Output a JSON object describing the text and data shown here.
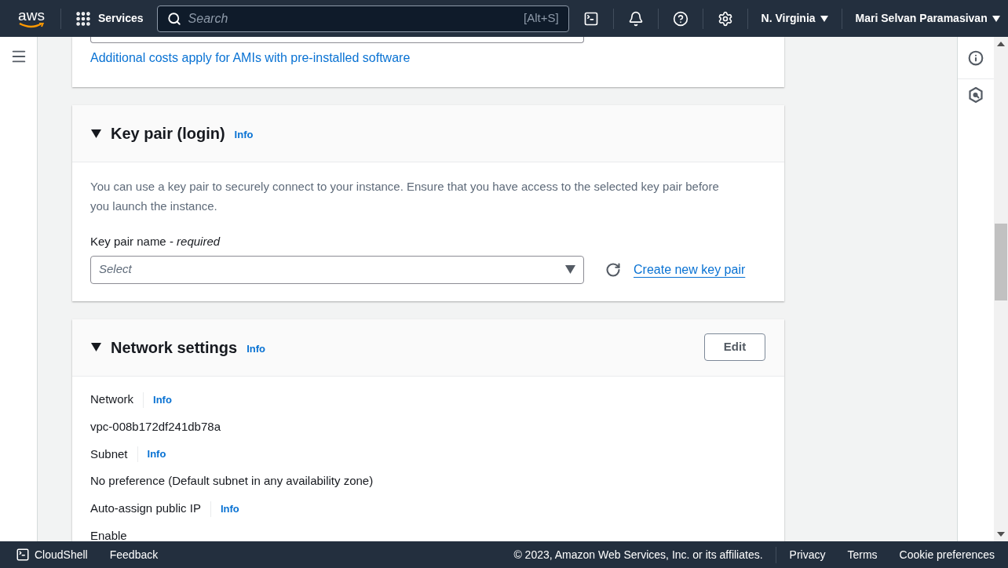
{
  "top_nav": {
    "logo": "aws",
    "services": "Services",
    "search": {
      "placeholder": "Search",
      "shortcut": "[Alt+S]"
    },
    "region": "N. Virginia",
    "user": "Mari Selvan Paramasivan"
  },
  "sections": [
    {
      "kind": "partial",
      "link": "Additional costs apply for AMIs with pre-installed software"
    },
    {
      "kind": "keypair",
      "title": "Key pair (login)",
      "expanded": true,
      "info": "Info",
      "description": "You can use a key pair to securely connect to your instance. Ensure that you have access to the selected key pair before you launch the instance.",
      "field_label": "Key pair name - *required*",
      "select": {
        "placeholder": "Select"
      },
      "link": "Create new key pair"
    },
    {
      "kind": "network",
      "title": "Network settings",
      "expanded": true,
      "info": "Info",
      "button": "Edit",
      "fields": [
        {
          "label": "Network",
          "info": "Info",
          "value": "vpc-008b172df241db78a"
        },
        {
          "label": "Subnet",
          "info": "Info",
          "value": "No preference (Default subnet in any availability zone)"
        },
        {
          "label": "Auto-assign public IP",
          "info": "Info",
          "value": "Enable"
        }
      ]
    }
  ],
  "footer": {
    "cloudshell": "CloudShell",
    "feedback": "Feedback",
    "copyright": "© 2023, Amazon Web Services, Inc. or its affiliates.",
    "links": [
      "Privacy",
      "Terms",
      "Cookie preferences"
    ]
  }
}
